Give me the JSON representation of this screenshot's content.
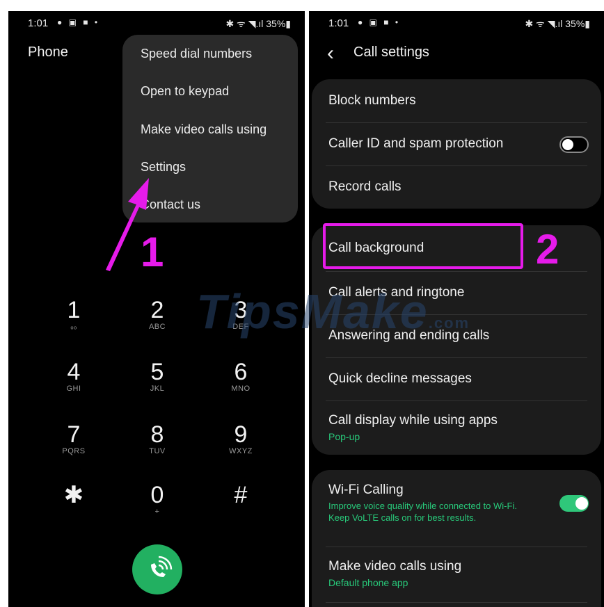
{
  "left": {
    "status": {
      "time": "1:01",
      "icons": "● ▣ ■ •",
      "right": "✱ ᯤ ◥.ıl 35%▮"
    },
    "title": "Phone",
    "menu": [
      "Speed dial numbers",
      "Open to keypad",
      "Make video calls using",
      "Settings",
      "Contact us"
    ],
    "keys": [
      {
        "num": "1",
        "sub": "ₒₒ"
      },
      {
        "num": "2",
        "sub": "ABC"
      },
      {
        "num": "3",
        "sub": "DEF"
      },
      {
        "num": "4",
        "sub": "GHI"
      },
      {
        "num": "5",
        "sub": "JKL"
      },
      {
        "num": "6",
        "sub": "MNO"
      },
      {
        "num": "7",
        "sub": "PQRS"
      },
      {
        "num": "8",
        "sub": "TUV"
      },
      {
        "num": "9",
        "sub": "WXYZ"
      },
      {
        "num": "✱",
        "sub": ""
      },
      {
        "num": "0",
        "sub": "+"
      },
      {
        "num": "#",
        "sub": ""
      }
    ],
    "step": "1"
  },
  "right": {
    "status": {
      "time": "1:01",
      "icons": "● ▣ ■ •",
      "right": "✱ ᯤ ◥.ıl 35%▮"
    },
    "back": "‹",
    "title": "Call settings",
    "group1": {
      "block": "Block numbers",
      "callerid": "Caller ID and spam protection",
      "record": "Record calls"
    },
    "group2": {
      "background": "Call background",
      "alerts": "Call alerts and ringtone",
      "answering": "Answering and ending calls",
      "decline": "Quick decline messages",
      "display": "Call display while using apps",
      "display_sub": "Pop-up"
    },
    "group3": {
      "wifi": "Wi-Fi Calling",
      "wifi_sub1": "Improve voice quality while connected to Wi-Fi.",
      "wifi_sub2": "Keep VoLTE calls on for best results.",
      "video": "Make video calls using",
      "video_sub": "Default phone app"
    },
    "step": "2"
  },
  "watermark": {
    "main": "TipsMake",
    "suffix": ".com"
  },
  "colors": {
    "accent": "#e61bea",
    "green": "#22b061",
    "toggle_on": "#2fc77a"
  }
}
